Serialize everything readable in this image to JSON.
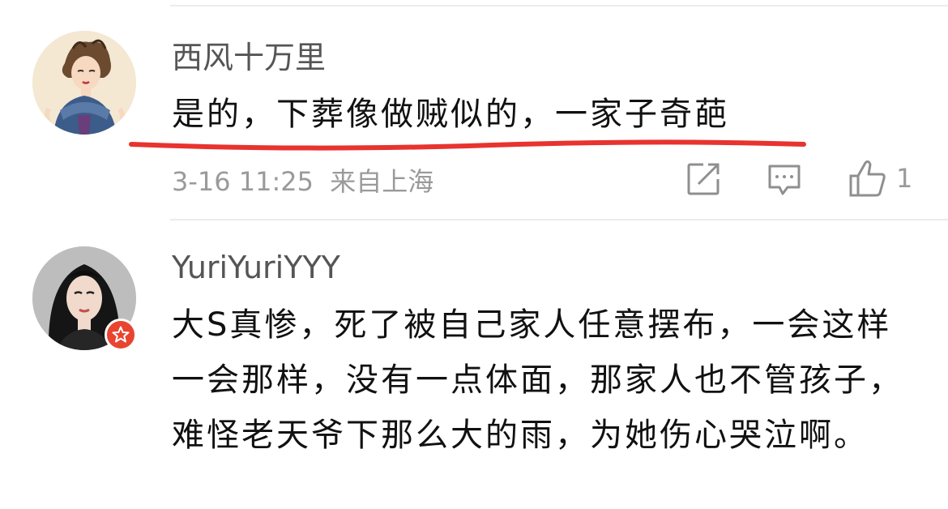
{
  "comments": [
    {
      "username": "西风十万里",
      "text": "是的，下葬像做贼似的，一家子奇葩",
      "timestamp": "3-16 11:25",
      "location": "来自上海",
      "likes": "1",
      "avatar": "cartoon-woman-avatar"
    },
    {
      "username": "YuriYuriYYY",
      "text": "大S真惨，死了被自己家人任意摆布，一会这样一会那样，没有一点体面，那家人也不管孩子，难怪老天爷下那么大的雨，为她伤心哭泣啊。",
      "avatar": "woman-portrait-avatar",
      "badge": "verified-star-icon"
    }
  ],
  "icons": {
    "share": "share-icon",
    "reply": "comment-icon",
    "like": "thumbs-up-icon"
  },
  "colors": {
    "underline": "#e8332e",
    "badge": "#e8442f",
    "meta": "#9a9a9a"
  }
}
